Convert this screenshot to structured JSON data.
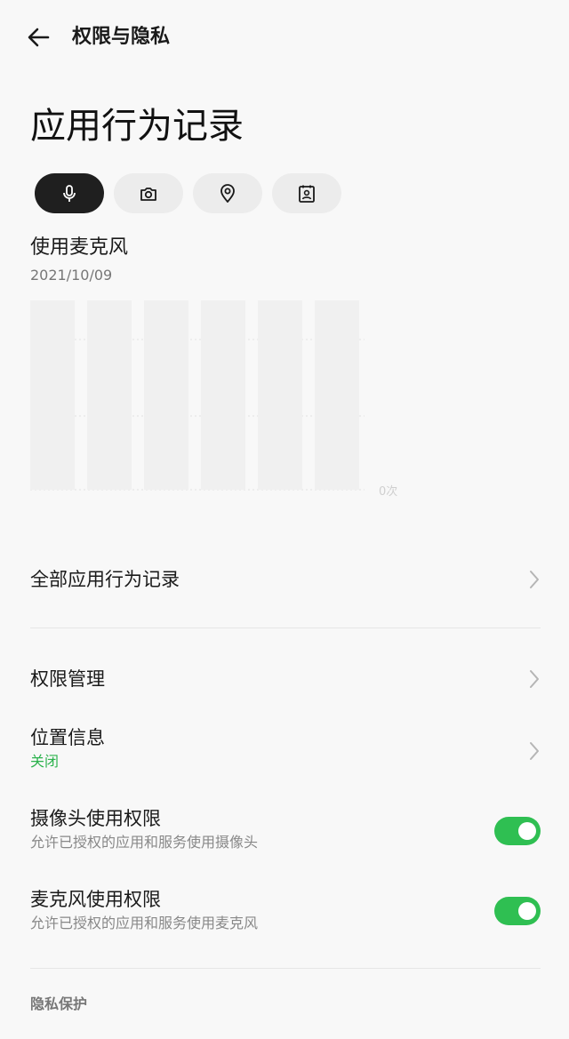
{
  "header": {
    "title": "权限与隐私",
    "back_icon": "back-arrow-icon"
  },
  "page_title": "应用行为记录",
  "filter_chips": [
    {
      "icon": "microphone-icon",
      "active": true
    },
    {
      "icon": "camera-icon",
      "active": false
    },
    {
      "icon": "location-pin-icon",
      "active": false
    },
    {
      "icon": "contacts-icon",
      "active": false
    }
  ],
  "usage": {
    "title": "使用麦克风",
    "date": "2021/10/09"
  },
  "chart_data": {
    "type": "bar",
    "categories": [
      "",
      "",
      "",
      "",
      "",
      ""
    ],
    "values": [
      0,
      0,
      0,
      0,
      0,
      0
    ],
    "y_axis_label": "0次",
    "gridlines": true
  },
  "menu": {
    "all_records": "全部应用行为记录",
    "permission_management": "权限管理",
    "location": {
      "title": "位置信息",
      "status": "关闭"
    },
    "camera_permission": {
      "title": "摄像头使用权限",
      "description": "允许已授权的应用和服务使用摄像头",
      "enabled": true
    },
    "microphone_permission": {
      "title": "麦克风使用权限",
      "description": "允许已授权的应用和服务使用麦克风",
      "enabled": true
    }
  },
  "section": {
    "privacy_protection": "隐私保护"
  },
  "colors": {
    "accent_green": "#2fbf52",
    "status_green": "#2bb24c",
    "active_chip": "#1f1f1f"
  }
}
